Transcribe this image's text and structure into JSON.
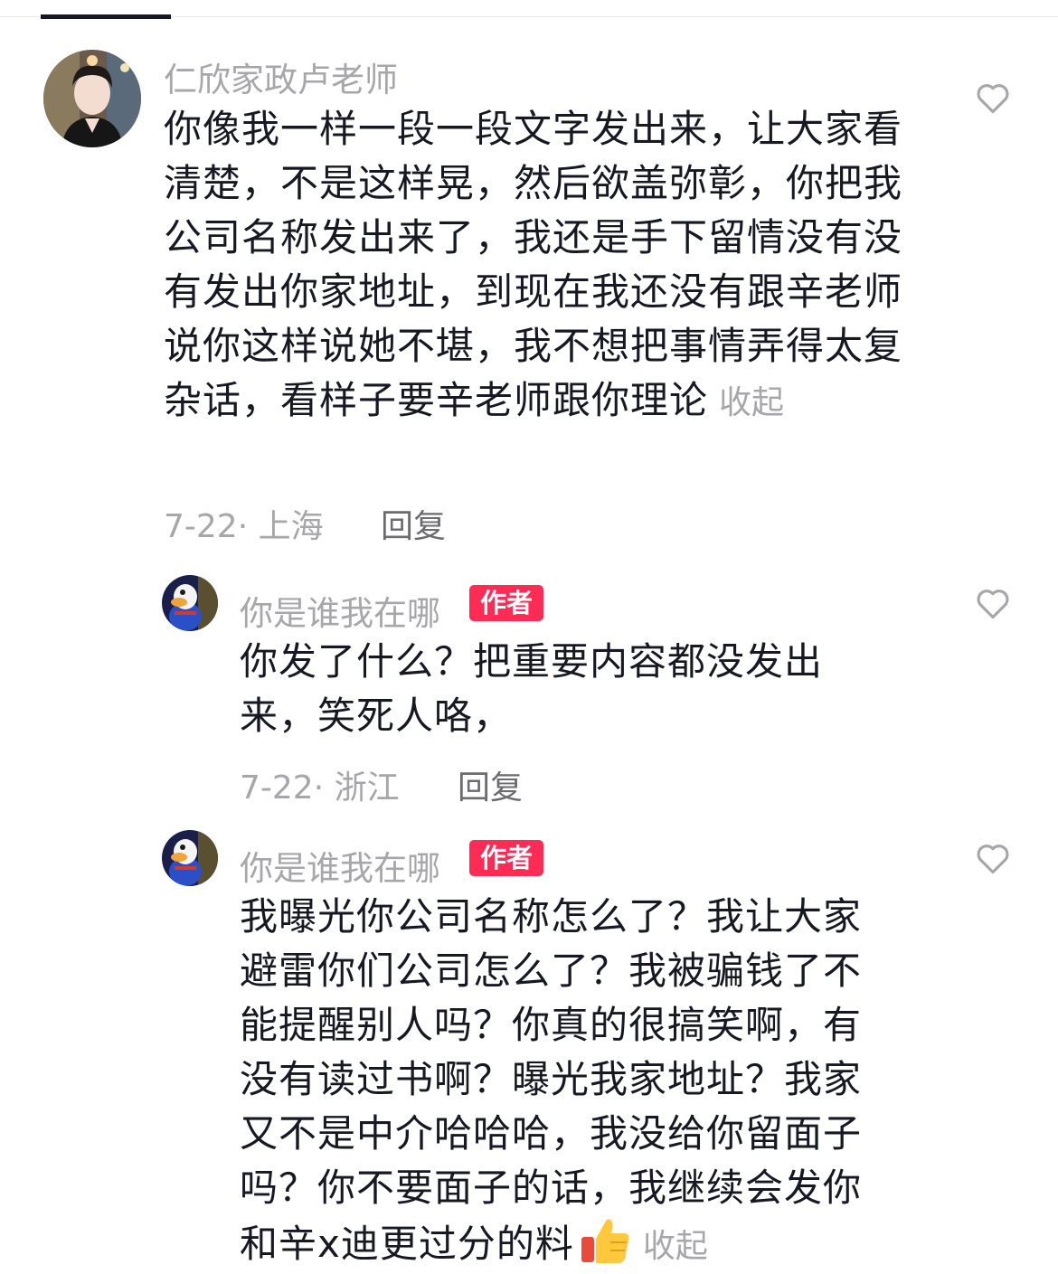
{
  "comments": [
    {
      "username": "仁欣家政卢老师",
      "text": "你像我一样一段一段文字发出来，让大家看清楚，不是这样晃，然后欲盖弥彰，你把我公司名称发出来了，我还是手下留情没有没有发出你家地址，到现在我还没有跟辛老师说你这样说她不堪，我不想把事情弄得太复杂话，看样子要辛老师跟你理论",
      "collapse_label": "收起",
      "meta": "7-22· 上海",
      "reply_label": "回复"
    },
    {
      "username": "你是谁我在哪",
      "badge": "作者",
      "text": "你发了什么？把重要内容都没发出来，笑死人咯，",
      "meta": "7-22· 浙江",
      "reply_label": "回复"
    },
    {
      "username": "你是谁我在哪",
      "badge": "作者",
      "text": "我曝光你公司名称怎么了？我让大家避雷你们公司怎么了？我被骗钱了不能提醒别人吗？你真的很搞笑啊，有没有读过书啊？曝光我家地址？我家又不是中介哈哈哈，我没给你留面子吗？你不要面子的话，我继续会发你和辛x迪更过分的料",
      "emoji": "thumbs-up-icon",
      "collapse_label": "收起"
    }
  ],
  "colors": {
    "badge": "#fe2c55",
    "text": "#161823",
    "muted": "#a6a6ab"
  }
}
